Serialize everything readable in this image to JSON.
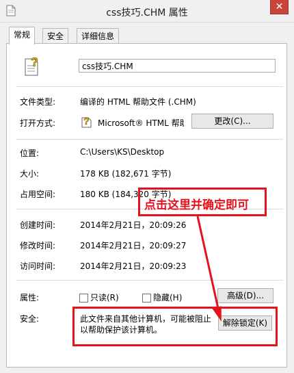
{
  "window": {
    "title": "css技巧.CHM 属性",
    "close_glyph": "✕"
  },
  "tabs": [
    {
      "label": "常规"
    },
    {
      "label": "安全"
    },
    {
      "label": "详细信息"
    }
  ],
  "general": {
    "file_name": "css技巧.CHM",
    "type_label": "文件类型:",
    "type_value": "编译的 HTML 帮助文件 (.CHM)",
    "open_with_label": "打开方式:",
    "open_with_value": "Microsoft® HTML 帮助",
    "change_button": "更改(C)...",
    "location_label": "位置:",
    "location_value": "C:\\Users\\KS\\Desktop",
    "size_label": "大小:",
    "size_value": "178 KB (182,671 字节)",
    "size_on_disk_label": "占用空间:",
    "size_on_disk_value": "180 KB (184,320 字节)",
    "created_label": "创建时间:",
    "created_value": "2014年2月21日，20:09:26",
    "modified_label": "修改时间:",
    "modified_value": "2014年2月21日，20:09:27",
    "accessed_label": "访问时间:",
    "accessed_value": "2014年2月21日，20:09:23",
    "attributes_label": "属性:",
    "readonly_label": "只读(R)",
    "hidden_label": "隐藏(H)",
    "advanced_button": "高级(D)...",
    "security_label": "安全:",
    "security_message_line1": "此文件来自其他计算机，可能被阻止",
    "security_message_line2": "以帮助保护该计算机。",
    "unblock_button": "解除锁定(K)"
  },
  "annotation": {
    "callout_text": "点击这里并确定即可"
  },
  "colors": {
    "annotation_red": "#e5121b",
    "close_red": "#c7453a"
  },
  "icons": [
    "document-icon",
    "close-icon",
    "chm-file-icon",
    "help-app-icon",
    "annotation-arrow"
  ]
}
